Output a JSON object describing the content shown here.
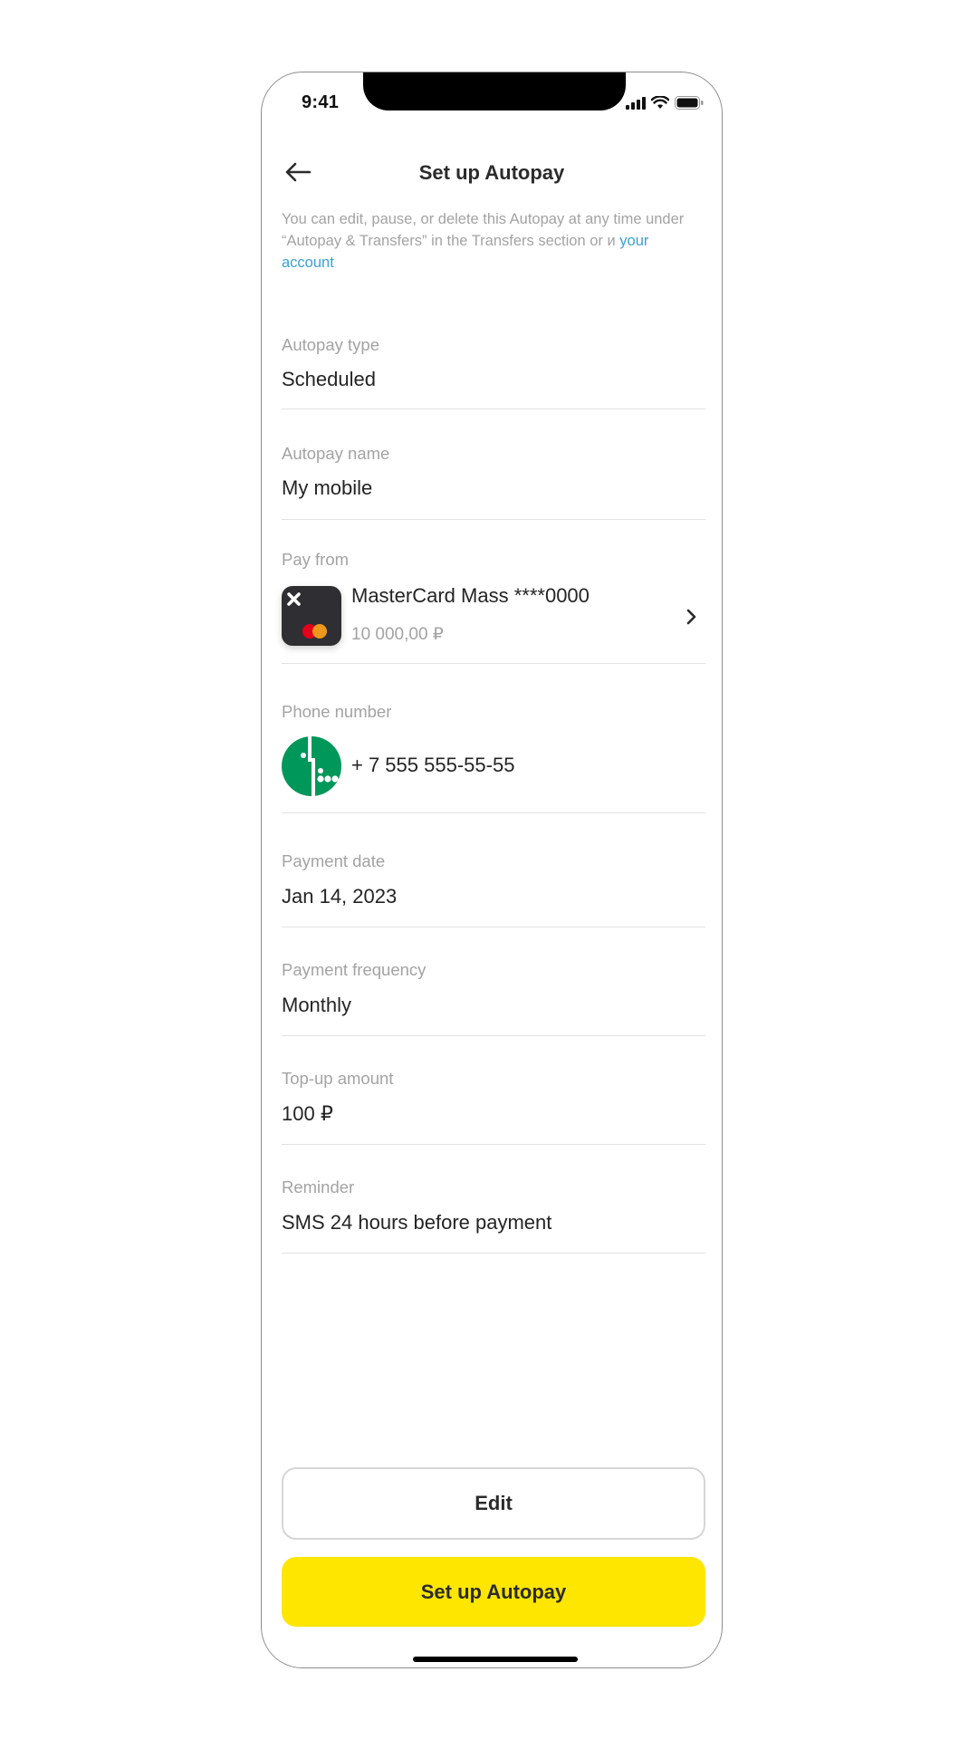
{
  "status_bar": {
    "time": "9:41"
  },
  "header": {
    "title": "Set up Autopay"
  },
  "info": {
    "text": "You can edit, pause, or delete this Autopay at any time under “Autopay & Transfers” in the Transfers section or и ",
    "link": "your account"
  },
  "fields": {
    "autopay_type": {
      "label": "Autopay type",
      "value": "Scheduled"
    },
    "autopay_name": {
      "label": "Autopay name",
      "value": "My mobile"
    },
    "pay_from": {
      "label": "Pay from",
      "card_name": "MasterCard Mass ****0000",
      "balance": "10 000,00 ₽"
    },
    "phone_number": {
      "label": "Phone number",
      "value": "+ 7 555 555-55-55"
    },
    "payment_date": {
      "label": "Payment date",
      "value": "Jan 14, 2023"
    },
    "payment_frequency": {
      "label": "Payment frequency",
      "value": "Monthly"
    },
    "top_up_amount": {
      "label": "Top-up amount",
      "value": "100 ₽"
    },
    "reminder": {
      "label": "Reminder",
      "value": "SMS 24 hours before payment"
    }
  },
  "buttons": {
    "edit": "Edit",
    "setup": "Set up Autopay"
  },
  "colors": {
    "accent_yellow": "#ffe600",
    "link_blue": "#3aa1d6",
    "operator_green": "#00975a"
  },
  "icons": {
    "back": "arrow-left-icon",
    "card": "card-logo-icon",
    "operator": "mobile-operator-icon",
    "chevron": "chevron-right-icon"
  }
}
